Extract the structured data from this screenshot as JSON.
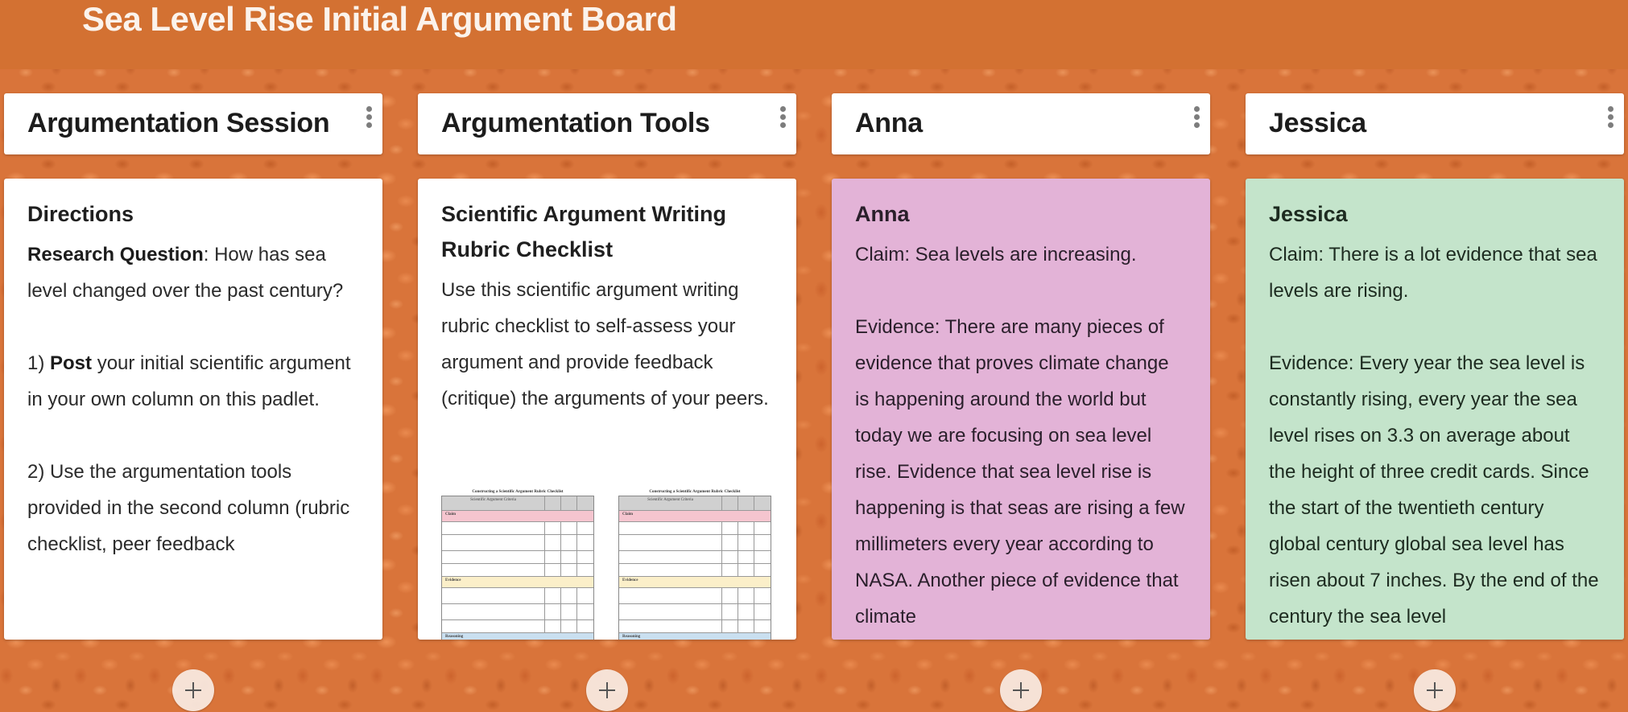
{
  "board": {
    "title": "Sea Level Rise Initial Argument Board",
    "colors": {
      "header_bar": "#d37132",
      "background": "#d9743a",
      "anna_card": "#e3b3d7",
      "jessica_card": "#c4e4cb"
    }
  },
  "columns": [
    {
      "title": "Argumentation Session",
      "menu_icon": "more-vertical-icon",
      "card": {
        "title": "Directions",
        "paragraphs": [
          {
            "bold": "Research Question",
            "text": ": How has sea level changed over the past century?"
          },
          {
            "prefix": "1) ",
            "bold": "Post",
            "text": " your initial scientific argument in your own column on this padlet."
          },
          {
            "prefix": "2) Use the argumentation tools provided in the second column (rubric checklist, peer feedback"
          }
        ]
      },
      "add_icon": "plus-icon"
    },
    {
      "title": "Argumentation Tools",
      "menu_icon": "more-vertical-icon",
      "card": {
        "title": "Scientific Argument Writing Rubric Checklist",
        "body": "Use this scientific argument writing rubric checklist to self-assess your argument and provide feedback (critique) the arguments of your peers.",
        "attachment": {
          "type": "image-thumbnail",
          "pages": [
            {
              "title": "Constructing a Scientific Argument Rubric Checklist",
              "header": "Scientific Argument Criteria",
              "sections": [
                "Claim",
                "Evidence",
                "Reasoning"
              ]
            },
            {
              "title": "Constructing a Scientific Argument Rubric Checklist",
              "header": "Scientific Argument Criteria",
              "sections": [
                "Claim",
                "Evidence",
                "Reasoning"
              ]
            }
          ]
        }
      },
      "add_icon": "plus-icon"
    },
    {
      "title": "Anna",
      "menu_icon": "more-vertical-icon",
      "card": {
        "title": "Anna",
        "claim": "Claim: Sea levels are increasing.",
        "evidence": "Evidence: There are many pieces of evidence that proves climate change is happening around the world but today we are focusing on sea level rise. Evidence that sea level rise is happening is that seas are rising a few millimeters every year according to NASA. Another piece of evidence that climate"
      },
      "add_icon": "plus-icon"
    },
    {
      "title": "Jessica",
      "menu_icon": "more-vertical-icon",
      "card": {
        "title": "Jessica",
        "claim": "Claim: There is a lot evidence that sea levels are rising.",
        "evidence": "Evidence: Every year the sea level is constantly rising, every year the sea level rises on 3.3 on average about the height of three credit cards. Since the start of the twentieth century global century global sea level has risen about 7 inches.  By the end of the century the sea level"
      },
      "add_icon": "plus-icon"
    }
  ]
}
